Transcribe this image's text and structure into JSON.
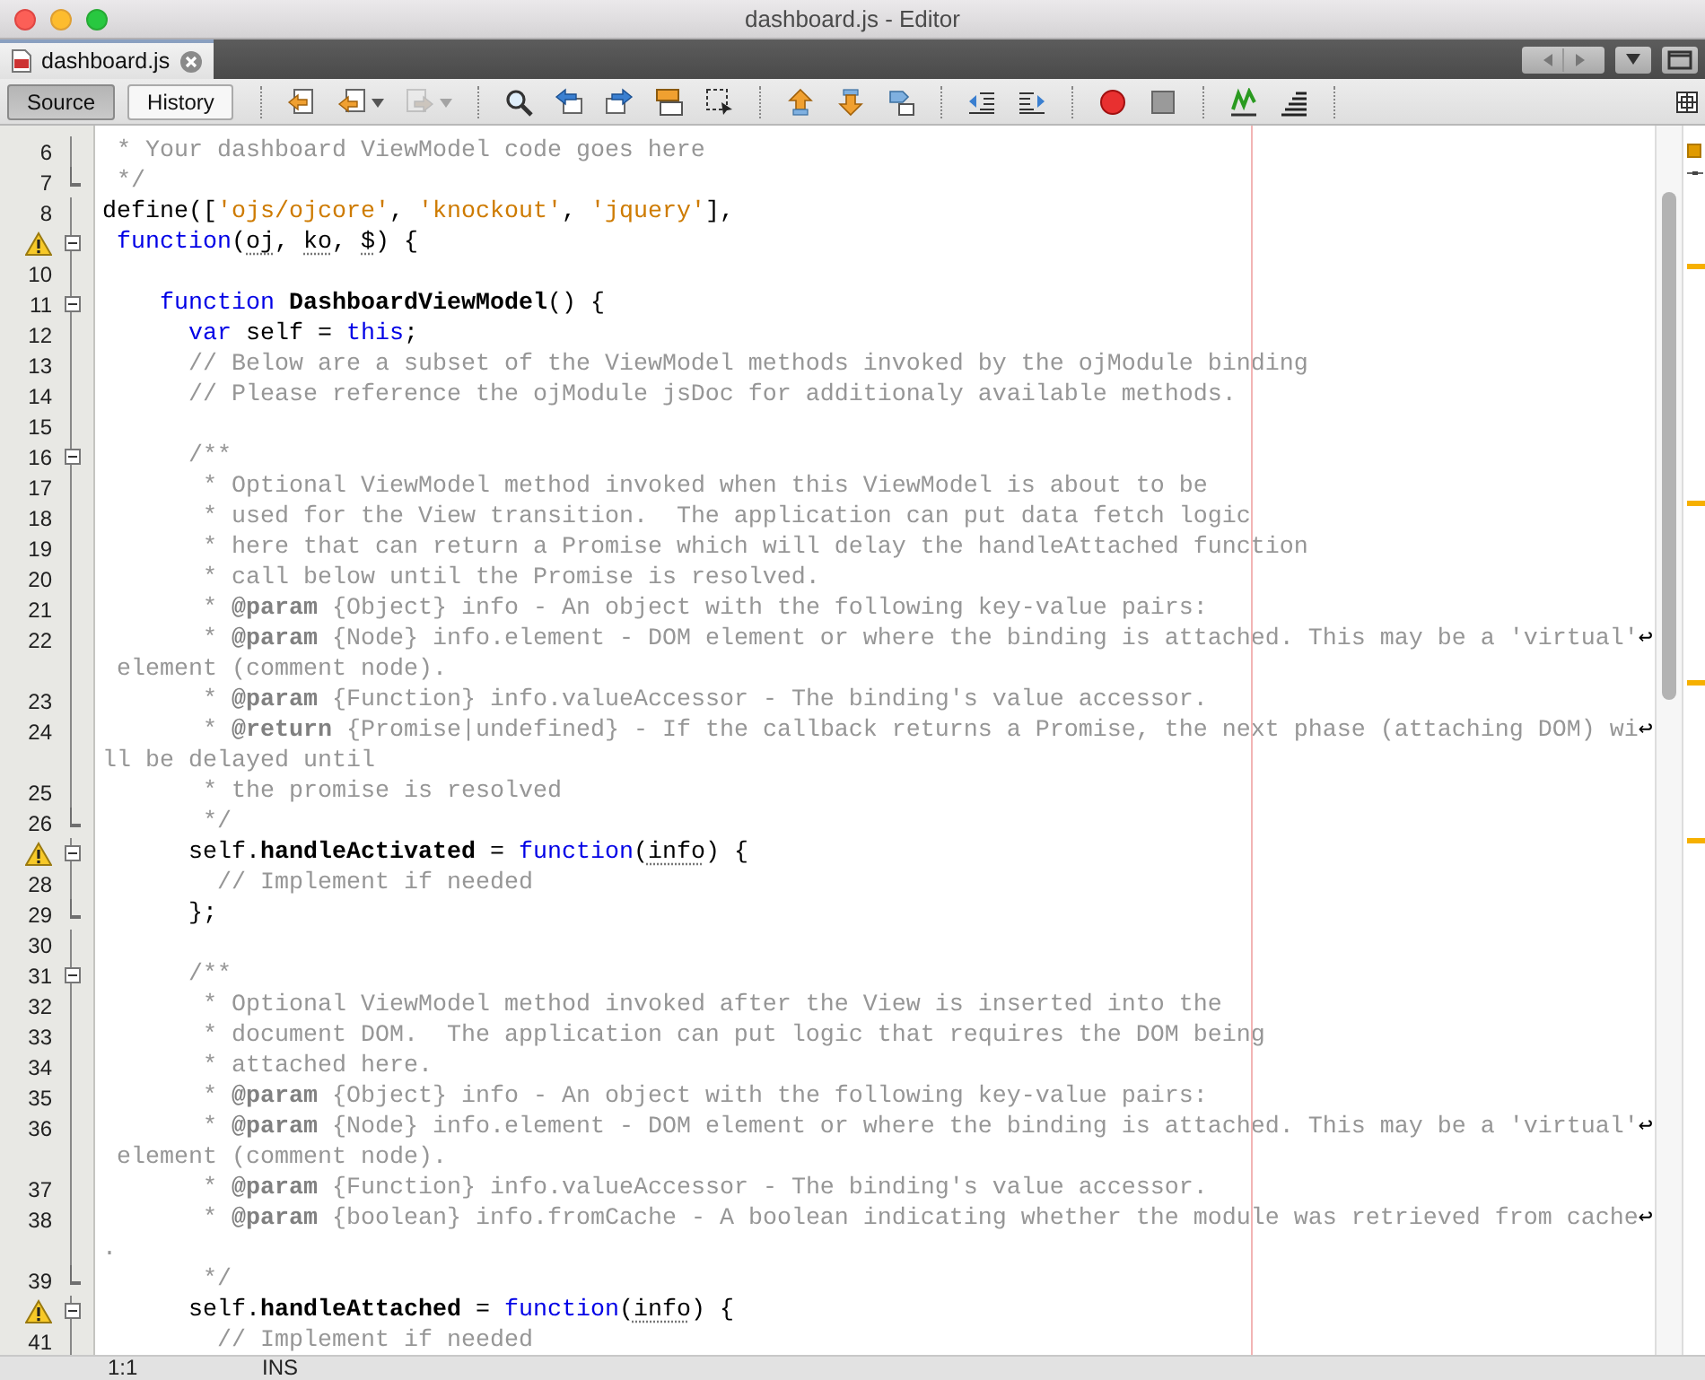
{
  "window": {
    "title": "dashboard.js - Editor"
  },
  "tabs": [
    {
      "label": "dashboard.js",
      "selected": true
    }
  ],
  "toolbar": {
    "views": [
      {
        "label": "Source",
        "selected": true
      },
      {
        "label": "History",
        "selected": false
      }
    ],
    "tool_groups": [
      [
        {
          "disabled": false,
          "dropdown": false
        },
        {
          "disabled": false,
          "dropdown": true
        },
        {
          "disabled": true,
          "dropdown": true
        }
      ],
      [
        {
          "disabled": false,
          "dropdown": false
        },
        {
          "disabled": false,
          "dropdown": false
        },
        {
          "disabled": false,
          "dropdown": false
        },
        {
          "disabled": false,
          "dropdown": false
        },
        {
          "disabled": false,
          "dropdown": false
        }
      ],
      [
        {
          "disabled": false,
          "dropdown": false
        },
        {
          "disabled": false,
          "dropdown": false
        },
        {
          "disabled": false,
          "dropdown": false
        }
      ],
      [
        {
          "disabled": false,
          "dropdown": false
        },
        {
          "disabled": false,
          "dropdown": false
        }
      ],
      [
        {
          "disabled": false,
          "dropdown": false
        },
        {
          "disabled": false,
          "dropdown": false
        }
      ],
      [
        {
          "disabled": false,
          "dropdown": false
        },
        {
          "disabled": false,
          "dropdown": false
        }
      ]
    ]
  },
  "editor": {
    "lines": [
      {
        "number": "6",
        "warning": false,
        "fold_start": false,
        "fold_end": false,
        "spans": [
          {
            "kind": "comment",
            "text": " * Your dashboard ViewModel code goes here"
          }
        ]
      },
      {
        "number": "7",
        "warning": false,
        "fold_start": false,
        "fold_end": true,
        "spans": [
          {
            "kind": "comment",
            "text": " */"
          }
        ]
      },
      {
        "number": "8",
        "warning": false,
        "fold_start": false,
        "fold_end": false,
        "spans": [
          {
            "kind": "plain",
            "text": "define(["
          },
          {
            "kind": "string",
            "text": "'ojs/ojcore'"
          },
          {
            "kind": "plain",
            "text": ", "
          },
          {
            "kind": "string",
            "text": "'knockout'"
          },
          {
            "kind": "plain",
            "text": ", "
          },
          {
            "kind": "string",
            "text": "'jquery'"
          },
          {
            "kind": "plain",
            "text": "],"
          }
        ]
      },
      {
        "warning": true,
        "fold_start": true,
        "fold_end": false,
        "spans": [
          {
            "kind": "keyword",
            "text": " function"
          },
          {
            "kind": "plain",
            "text": "("
          },
          {
            "kind": "unused",
            "text": "oj"
          },
          {
            "kind": "plain",
            "text": ", "
          },
          {
            "kind": "unused",
            "text": "ko"
          },
          {
            "kind": "plain",
            "text": ", "
          },
          {
            "kind": "unused",
            "text": "$"
          },
          {
            "kind": "plain",
            "text": ") {"
          }
        ]
      },
      {
        "number": "10",
        "warning": false,
        "fold_start": false,
        "fold_end": false
      },
      {
        "number": "11",
        "warning": false,
        "fold_start": true,
        "fold_end": false,
        "spans": [
          {
            "kind": "keyword",
            "text": "    function"
          },
          {
            "kind": "bold",
            "text": " DashboardViewModel"
          },
          {
            "kind": "plain",
            "text": "() {"
          }
        ]
      },
      {
        "number": "12",
        "warning": false,
        "fold_start": false,
        "fold_end": false,
        "spans": [
          {
            "kind": "keyword",
            "text": "      var"
          },
          {
            "kind": "plain",
            "text": " self = "
          },
          {
            "kind": "keyword",
            "text": "this"
          },
          {
            "kind": "plain",
            "text": ";"
          }
        ]
      },
      {
        "number": "13",
        "warning": false,
        "fold_start": false,
        "fold_end": false,
        "spans": [
          {
            "kind": "comment",
            "text": "      // Below are a subset of the ViewModel methods invoked by the ojModule binding"
          }
        ]
      },
      {
        "number": "14",
        "warning": false,
        "fold_start": false,
        "fold_end": false,
        "spans": [
          {
            "kind": "comment",
            "text": "      // Please reference the ojModule jsDoc for additionaly available methods."
          }
        ]
      },
      {
        "number": "15",
        "warning": false,
        "fold_start": false,
        "fold_end": false
      },
      {
        "number": "16",
        "warning": false,
        "fold_start": true,
        "fold_end": false,
        "spans": [
          {
            "kind": "comment",
            "text": "      /**"
          }
        ]
      },
      {
        "number": "17",
        "warning": false,
        "fold_start": false,
        "fold_end": false,
        "spans": [
          {
            "kind": "comment",
            "text": "       * Optional ViewModel method invoked when this ViewModel is about to be"
          }
        ]
      },
      {
        "number": "18",
        "warning": false,
        "fold_start": false,
        "fold_end": false,
        "spans": [
          {
            "kind": "comment",
            "text": "       * used for the View transition.  The application can put data fetch logic"
          }
        ]
      },
      {
        "number": "19",
        "warning": false,
        "fold_start": false,
        "fold_end": false,
        "spans": [
          {
            "kind": "comment",
            "text": "       * here that can return a Promise which will delay the handleAttached function"
          }
        ]
      },
      {
        "number": "20",
        "warning": false,
        "fold_start": false,
        "fold_end": false,
        "spans": [
          {
            "kind": "comment",
            "text": "       * call below until the Promise is resolved."
          }
        ]
      },
      {
        "number": "21",
        "warning": false,
        "fold_start": false,
        "fold_end": false,
        "spans": [
          {
            "kind": "comment",
            "text": "       * "
          },
          {
            "kind": "doctag",
            "text": "@param"
          },
          {
            "kind": "comment",
            "text": " {Object} info - An object with the following key-value pairs:"
          }
        ]
      },
      {
        "number": "22",
        "warning": false,
        "fold_start": false,
        "fold_end": false,
        "spans": [
          {
            "kind": "comment",
            "text": "       * "
          },
          {
            "kind": "doctag",
            "text": "@param"
          },
          {
            "kind": "comment",
            "text": " {Node} info.element - DOM element or where the binding is attached. This may be a 'virtual'"
          },
          {
            "kind": "wrap",
            "text": "↩"
          }
        ],
        "continuation": [
          {
            "kind": "comment",
            "text": " element (comment node)."
          }
        ]
      },
      {
        "number": "23",
        "warning": false,
        "fold_start": false,
        "fold_end": false,
        "spans": [
          {
            "kind": "comment",
            "text": "       * "
          },
          {
            "kind": "doctag",
            "text": "@param"
          },
          {
            "kind": "comment",
            "text": " {Function} info.valueAccessor - The binding's value accessor."
          }
        ]
      },
      {
        "number": "24",
        "warning": false,
        "fold_start": false,
        "fold_end": false,
        "spans": [
          {
            "kind": "comment",
            "text": "       * "
          },
          {
            "kind": "doctag",
            "text": "@return"
          },
          {
            "kind": "comment",
            "text": " {Promise|undefined} - If the callback returns a Promise, the next phase (attaching DOM) wi"
          },
          {
            "kind": "wrap",
            "text": "↩"
          }
        ],
        "continuation": [
          {
            "kind": "comment",
            "text": "ll be delayed until"
          }
        ]
      },
      {
        "number": "25",
        "warning": false,
        "fold_start": false,
        "fold_end": false,
        "spans": [
          {
            "kind": "comment",
            "text": "       * the promise is resolved"
          }
        ]
      },
      {
        "number": "26",
        "warning": false,
        "fold_start": false,
        "fold_end": true,
        "spans": [
          {
            "kind": "comment",
            "text": "       */"
          }
        ]
      },
      {
        "warning": true,
        "fold_start": true,
        "fold_end": false,
        "spans": [
          {
            "kind": "plain",
            "text": "      self."
          },
          {
            "kind": "bold",
            "text": "handleActivated"
          },
          {
            "kind": "plain",
            "text": " = "
          },
          {
            "kind": "keyword",
            "text": "function"
          },
          {
            "kind": "plain",
            "text": "("
          },
          {
            "kind": "unused",
            "text": "info"
          },
          {
            "kind": "plain",
            "text": ") {"
          }
        ]
      },
      {
        "number": "28",
        "warning": false,
        "fold_start": false,
        "fold_end": false,
        "spans": [
          {
            "kind": "comment",
            "text": "        // Implement if needed"
          }
        ]
      },
      {
        "number": "29",
        "warning": false,
        "fold_start": false,
        "fold_end": true,
        "spans": [
          {
            "kind": "plain",
            "text": "      };"
          }
        ]
      },
      {
        "number": "30",
        "warning": false,
        "fold_start": false,
        "fold_end": false
      },
      {
        "number": "31",
        "warning": false,
        "fold_start": true,
        "fold_end": false,
        "spans": [
          {
            "kind": "comment",
            "text": "      /**"
          }
        ]
      },
      {
        "number": "32",
        "warning": false,
        "fold_start": false,
        "fold_end": false,
        "spans": [
          {
            "kind": "comment",
            "text": "       * Optional ViewModel method invoked after the View is inserted into the"
          }
        ]
      },
      {
        "number": "33",
        "warning": false,
        "fold_start": false,
        "fold_end": false,
        "spans": [
          {
            "kind": "comment",
            "text": "       * document DOM.  The application can put logic that requires the DOM being"
          }
        ]
      },
      {
        "number": "34",
        "warning": false,
        "fold_start": false,
        "fold_end": false,
        "spans": [
          {
            "kind": "comment",
            "text": "       * attached here."
          }
        ]
      },
      {
        "number": "35",
        "warning": false,
        "fold_start": false,
        "fold_end": false,
        "spans": [
          {
            "kind": "comment",
            "text": "       * "
          },
          {
            "kind": "doctag",
            "text": "@param"
          },
          {
            "kind": "comment",
            "text": " {Object} info - An object with the following key-value pairs:"
          }
        ]
      },
      {
        "number": "36",
        "warning": false,
        "fold_start": false,
        "fold_end": false,
        "spans": [
          {
            "kind": "comment",
            "text": "       * "
          },
          {
            "kind": "doctag",
            "text": "@param"
          },
          {
            "kind": "comment",
            "text": " {Node} info.element - DOM element or where the binding is attached. This may be a 'virtual'"
          },
          {
            "kind": "wrap",
            "text": "↩"
          }
        ],
        "continuation": [
          {
            "kind": "comment",
            "text": " element (comment node)."
          }
        ]
      },
      {
        "number": "37",
        "warning": false,
        "fold_start": false,
        "fold_end": false,
        "spans": [
          {
            "kind": "comment",
            "text": "       * "
          },
          {
            "kind": "doctag",
            "text": "@param"
          },
          {
            "kind": "comment",
            "text": " {Function} info.valueAccessor - The binding's value accessor."
          }
        ]
      },
      {
        "number": "38",
        "warning": false,
        "fold_start": false,
        "fold_end": false,
        "spans": [
          {
            "kind": "comment",
            "text": "       * "
          },
          {
            "kind": "doctag",
            "text": "@param"
          },
          {
            "kind": "comment",
            "text": " {boolean} info.fromCache - A boolean indicating whether the module was retrieved from cache"
          },
          {
            "kind": "wrap",
            "text": "↩"
          }
        ],
        "continuation": [
          {
            "kind": "comment",
            "text": "."
          }
        ]
      },
      {
        "number": "39",
        "warning": false,
        "fold_start": false,
        "fold_end": true,
        "spans": [
          {
            "kind": "comment",
            "text": "       */"
          }
        ]
      },
      {
        "warning": true,
        "fold_start": true,
        "fold_end": false,
        "spans": [
          {
            "kind": "plain",
            "text": "      self."
          },
          {
            "kind": "bold",
            "text": "handleAttached"
          },
          {
            "kind": "plain",
            "text": " = "
          },
          {
            "kind": "keyword",
            "text": "function"
          },
          {
            "kind": "plain",
            "text": "("
          },
          {
            "kind": "unused",
            "text": "info"
          },
          {
            "kind": "plain",
            "text": ") {"
          }
        ]
      },
      {
        "number": "41",
        "warning": false,
        "fold_start": false,
        "fold_end": false,
        "spans": [
          {
            "kind": "comment",
            "text": "        // Implement if needed"
          }
        ]
      }
    ]
  },
  "status_bar": {
    "position": "1:1",
    "mode": "INS"
  }
}
